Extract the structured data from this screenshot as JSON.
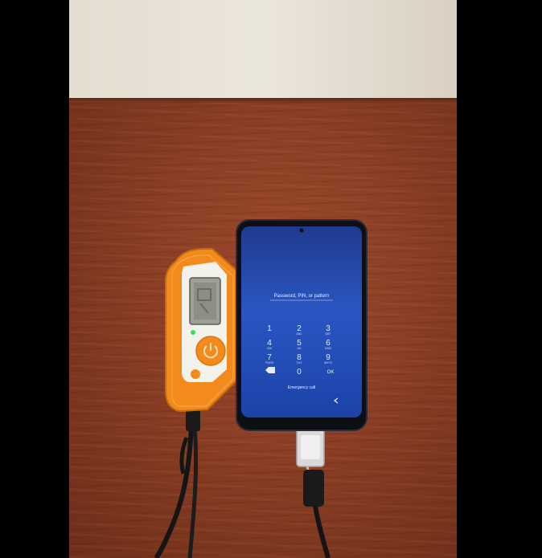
{
  "scene": {
    "description_label": "Photo of a handheld device connected by USB cable to a locked smartphone on a wooden table",
    "colors": {
      "wall": "#e8e2d6",
      "table": "#8a3e24",
      "device_body": "#f28a1c",
      "phone_screen": "#1c3f9e",
      "cable": "#1a1a1a"
    }
  },
  "phone": {
    "lock_message": "Password, PIN, or pattern",
    "keys": [
      "1",
      "2",
      "3",
      "4",
      "5",
      "6",
      "7",
      "8",
      "9",
      "0"
    ],
    "sub_letters": [
      "",
      "ABC",
      "DEF",
      "GHI",
      "JKL",
      "MNO",
      "PQRS",
      "TUV",
      "WXYZ"
    ],
    "ok_label": "OK",
    "emergency_label": "Emergency call"
  },
  "device": {
    "button_icon": "power-icon"
  }
}
